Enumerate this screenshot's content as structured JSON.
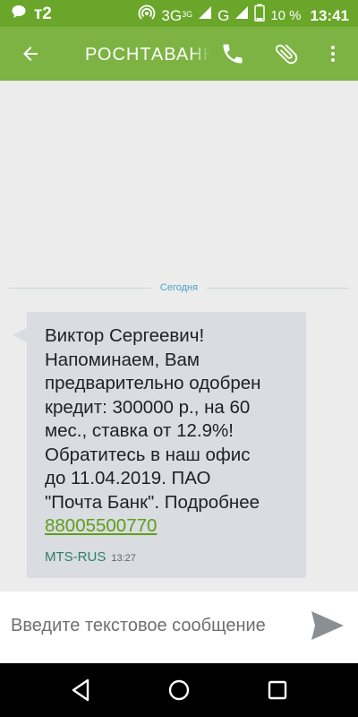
{
  "status_bar": {
    "carrier": "т2",
    "network_type": "3G",
    "network_sup": "3G",
    "network_type_2": "G",
    "battery": "10 %",
    "time": "13:41",
    "icons": [
      "chat-bubble-icon",
      "hotspot-icon",
      "signal-icon",
      "signal-icon",
      "battery-icon"
    ]
  },
  "toolbar": {
    "title": "РОСНТАВАНК",
    "icons": [
      "back-arrow-icon",
      "phone-icon",
      "paperclip-icon",
      "more-vert-icon"
    ]
  },
  "conversation": {
    "date_label": "Сегодня",
    "message": {
      "lines": [
        "Виктор Сергеевич!",
        "Напоминаем, Вам",
        "предварительно одобрен",
        "кредит: 300000 р., на 60",
        "мес., ставка от 12.9%!",
        "Обратитесь в наш офис",
        "до 11.04.2019. ПАО",
        "\"Почта Банк\". Подробнее"
      ],
      "phone": "88005500770",
      "sim": "MTS-RUS",
      "time": "13:27"
    }
  },
  "compose": {
    "placeholder": "Введите текстовое сообщение",
    "value": "",
    "send_icon": "send-icon"
  },
  "nav_bar": {
    "icons": [
      "nav-back-icon",
      "nav-home-icon",
      "nav-recents-icon"
    ]
  },
  "colors": {
    "status_bar": "#69a629",
    "toolbar": "#7cb342",
    "bubble": "#d9dce1",
    "link": "#5f9e1a",
    "date_label": "#4aa3c1"
  }
}
